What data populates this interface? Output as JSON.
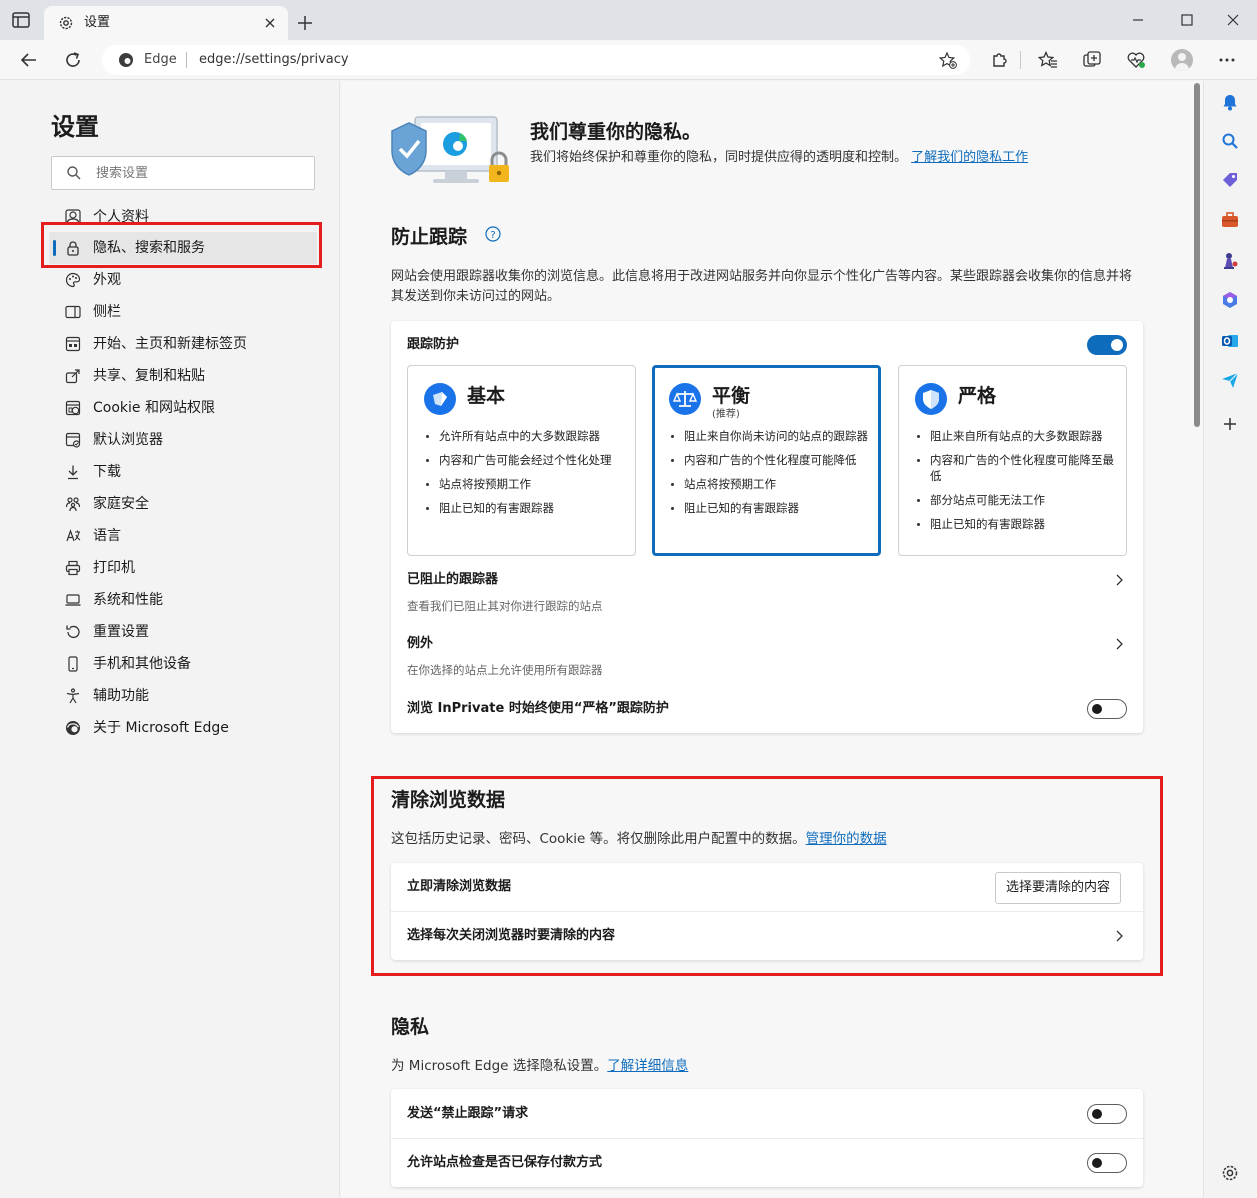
{
  "tab": {
    "title": "设置"
  },
  "address": {
    "site": "Edge",
    "url": "edge://settings/privacy"
  },
  "sidebar": {
    "title": "设置",
    "search_placeholder": "搜索设置",
    "items": [
      {
        "label": "个人资料",
        "icon": "profile-icon"
      },
      {
        "label": "隐私、搜索和服务",
        "icon": "lock-icon",
        "active": true
      },
      {
        "label": "外观",
        "icon": "palette-icon"
      },
      {
        "label": "侧栏",
        "icon": "sidebar-icon"
      },
      {
        "label": "开始、主页和新建标签页",
        "icon": "home-icon"
      },
      {
        "label": "共享、复制和粘贴",
        "icon": "share-icon"
      },
      {
        "label": "Cookie 和网站权限",
        "icon": "cookie-icon"
      },
      {
        "label": "默认浏览器",
        "icon": "browser-icon"
      },
      {
        "label": "下载",
        "icon": "download-icon"
      },
      {
        "label": "家庭安全",
        "icon": "family-icon"
      },
      {
        "label": "语言",
        "icon": "language-icon"
      },
      {
        "label": "打印机",
        "icon": "printer-icon"
      },
      {
        "label": "系统和性能",
        "icon": "system-icon"
      },
      {
        "label": "重置设置",
        "icon": "reset-icon"
      },
      {
        "label": "手机和其他设备",
        "icon": "phone-icon"
      },
      {
        "label": "辅助功能",
        "icon": "accessibility-icon"
      },
      {
        "label": "关于 Microsoft Edge",
        "icon": "edge-icon"
      }
    ]
  },
  "hero": {
    "title": "我们尊重你的隐私。",
    "desc": "我们将始终保护和尊重你的隐私，同时提供应得的透明度和控制。",
    "link": "了解我们的隐私工作"
  },
  "tracking": {
    "title": "防止跟踪",
    "desc": "网站会使用跟踪器收集你的浏览信息。此信息将用于改进网站服务并向你显示个性化广告等内容。某些跟踪器会收集你的信息并将其发送到你未访问过的网站。",
    "protection_label": "跟踪防护",
    "protection_on": true,
    "levels": [
      {
        "name": "基本",
        "note": "",
        "icon": "basic-icon",
        "selected": false,
        "bullets": [
          "允许所有站点中的大多数跟踪器",
          "内容和广告可能会经过个性化处理",
          "站点将按预期工作",
          "阻止已知的有害跟踪器"
        ]
      },
      {
        "name": "平衡",
        "note": "(推荐)",
        "icon": "balance-icon",
        "selected": true,
        "bullets": [
          "阻止来自你尚未访问的站点的跟踪器",
          "内容和广告的个性化程度可能降低",
          "站点将按预期工作",
          "阻止已知的有害跟踪器"
        ]
      },
      {
        "name": "严格",
        "note": "",
        "icon": "strict-shield-icon",
        "selected": false,
        "bullets": [
          "阻止来自所有站点的大多数跟踪器",
          "内容和广告的个性化程度可能降至最低",
          "部分站点可能无法工作",
          "阻止已知的有害跟踪器"
        ]
      }
    ],
    "blocked": {
      "label": "已阻止的跟踪器",
      "sub": "查看我们已阻止其对你进行跟踪的站点"
    },
    "exceptions": {
      "label": "例外",
      "sub": "在你选择的站点上允许使用所有跟踪器"
    },
    "inprivate": {
      "label": "浏览 InPrivate 时始终使用“严格”跟踪防护",
      "on": false
    }
  },
  "clear": {
    "title": "清除浏览数据",
    "desc": "这包括历史记录、密码、Cookie 等。将仅删除此用户配置中的数据。",
    "link": "管理你的数据",
    "now_label": "立即清除浏览数据",
    "now_button": "选择要清除的内容",
    "on_close_label": "选择每次关闭浏览器时要清除的内容"
  },
  "privacy": {
    "title": "隐私",
    "desc": "为 Microsoft Edge 选择隐私设置。",
    "link": "了解详细信息",
    "dnt_label": "发送“禁止跟踪”请求",
    "dnt_on": false,
    "payment_label": "允许站点检查是否已保存付款方式",
    "payment_on": false
  },
  "colors": {
    "accent": "#0f6cbd",
    "highlight_box": "#e41e1e"
  }
}
